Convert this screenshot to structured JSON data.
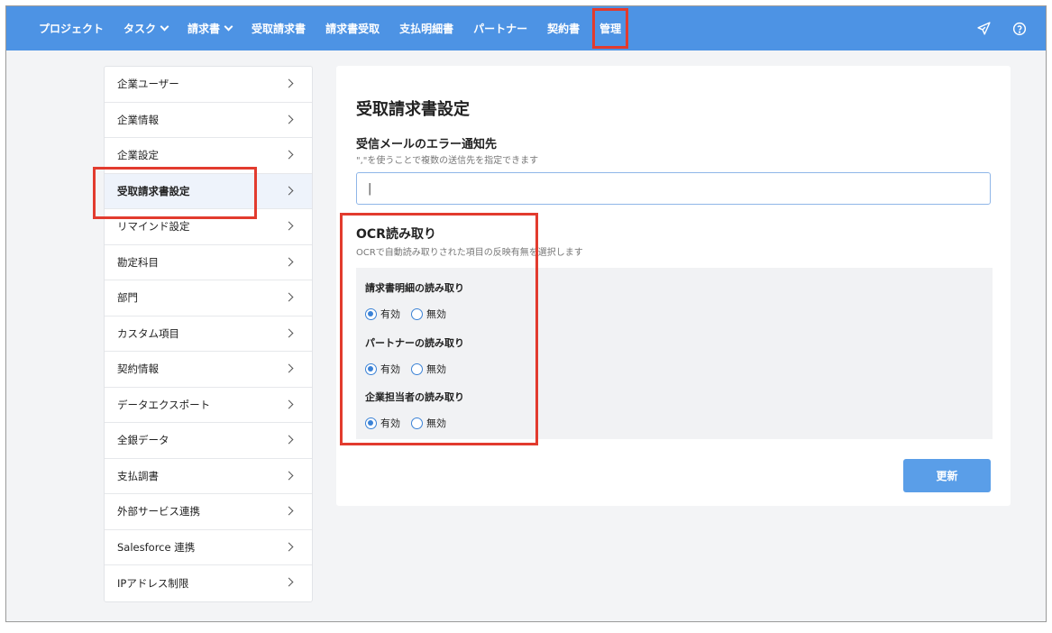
{
  "nav": {
    "items": [
      {
        "label": "プロジェクト",
        "dropdown": false
      },
      {
        "label": "タスク",
        "dropdown": true
      },
      {
        "label": "請求書",
        "dropdown": true
      },
      {
        "label": "受取請求書",
        "dropdown": false
      },
      {
        "label": "請求書受取",
        "dropdown": false
      },
      {
        "label": "支払明細書",
        "dropdown": false
      },
      {
        "label": "パートナー",
        "dropdown": false
      },
      {
        "label": "契約書",
        "dropdown": false
      },
      {
        "label": "管理",
        "dropdown": false
      }
    ],
    "send_icon": "paper-plane-icon",
    "help_icon": "help-circle-icon"
  },
  "sidebar": {
    "items": [
      {
        "label": "企業ユーザー"
      },
      {
        "label": "企業情報"
      },
      {
        "label": "企業設定"
      },
      {
        "label": "受取請求書設定"
      },
      {
        "label": "リマインド設定"
      },
      {
        "label": "勘定科目"
      },
      {
        "label": "部門"
      },
      {
        "label": "カスタム項目"
      },
      {
        "label": "契約情報"
      },
      {
        "label": "データエクスポート"
      },
      {
        "label": "全銀データ"
      },
      {
        "label": "支払調書"
      },
      {
        "label": "外部サービス連携"
      },
      {
        "label": "Salesforce 連携"
      },
      {
        "label": "IPアドレス制限"
      }
    ],
    "active_index": 3
  },
  "main": {
    "title": "受取請求書設定",
    "email_section": {
      "title": "受信メールのエラー通知先",
      "description": "\",\"を使うことで複数の送信先を指定できます",
      "value": "|"
    },
    "ocr_section": {
      "title": "OCR読み取り",
      "description": "OCRで自動読み取りされた項目の反映有無を選択します",
      "groups": [
        {
          "label": "請求書明細の読み取り",
          "options": [
            "有効",
            "無効"
          ],
          "selected": "有効"
        },
        {
          "label": "パートナーの読み取り",
          "options": [
            "有効",
            "無効"
          ],
          "selected": "有効"
        },
        {
          "label": "企業担当者の読み取り",
          "options": [
            "有効",
            "無効"
          ],
          "selected": "有効"
        }
      ]
    },
    "update_label": "更新"
  },
  "colors": {
    "topbar": "#4d93e4",
    "accent": "#3b82d6",
    "highlight": "#e23b2e"
  }
}
